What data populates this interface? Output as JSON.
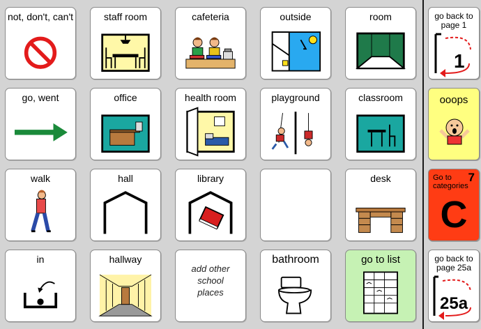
{
  "grid": {
    "row1": [
      "not, don't, can't",
      "staff room",
      "cafeteria",
      "outside",
      "room"
    ],
    "row2": [
      "go, went",
      "office",
      "health room",
      "playground",
      "classroom"
    ],
    "row3": [
      "walk",
      "hall",
      "library",
      "",
      "desk"
    ],
    "row4": [
      "in",
      "hallway",
      "add other school places",
      "bathroom",
      "go to list"
    ]
  },
  "note": {
    "line1": "add other",
    "line2": "school",
    "line3": "places"
  },
  "sidebar": {
    "back1": {
      "line1": "go back to",
      "line2": "page 1",
      "page": "1"
    },
    "ooops": "ooops",
    "categories": {
      "line1": "Go to",
      "line2": "categories",
      "number": "7",
      "letter": "C"
    },
    "back25": {
      "line1": "go back to",
      "line2": "page 25a",
      "page": "25a"
    }
  },
  "colors": {
    "background": "#d4d4d4",
    "go_to_list_bg": "#c6f2b4",
    "ooops_bg": "#ffff80",
    "categories_bg": "#ff3c14",
    "arrow_green": "#1a8a3a",
    "prohibit_red": "#e31b1b"
  }
}
